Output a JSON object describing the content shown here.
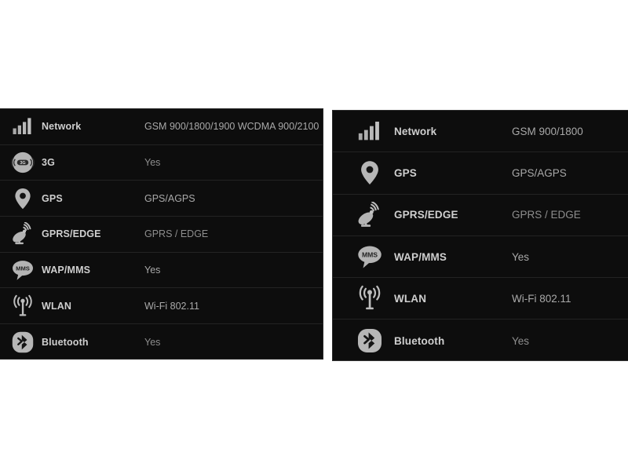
{
  "panels": [
    {
      "id": "left",
      "rows": [
        {
          "icon": "signal-bars-icon",
          "label": "Network",
          "value": "GSM 900/1800/1900 WCDMA 900/2100",
          "dim": false
        },
        {
          "icon": "three-g-badge-icon",
          "label": "3G",
          "value": "Yes",
          "dim": true
        },
        {
          "icon": "gps-pin-icon",
          "label": "GPS",
          "value": "GPS/AGPS",
          "dim": false
        },
        {
          "icon": "satellite-dish-icon",
          "label": "GPRS/EDGE",
          "value": "GPRS / EDGE",
          "dim": true
        },
        {
          "icon": "mms-bubble-icon",
          "label": "WAP/MMS",
          "value": "Yes",
          "dim": false
        },
        {
          "icon": "wlan-antenna-icon",
          "label": "WLAN",
          "value": "Wi-Fi 802.11",
          "dim": false
        },
        {
          "icon": "bluetooth-badge-icon",
          "label": "Bluetooth",
          "value": "Yes",
          "dim": true
        }
      ]
    },
    {
      "id": "right",
      "rows": [
        {
          "icon": "signal-bars-icon",
          "label": "Network",
          "value": "GSM 900/1800",
          "dim": false
        },
        {
          "icon": "gps-pin-icon",
          "label": "GPS",
          "value": "GPS/AGPS",
          "dim": false
        },
        {
          "icon": "satellite-dish-icon",
          "label": "GPRS/EDGE",
          "value": "GPRS / EDGE",
          "dim": true
        },
        {
          "icon": "mms-bubble-icon",
          "label": "WAP/MMS",
          "value": "Yes",
          "dim": false
        },
        {
          "icon": "wlan-antenna-icon",
          "label": "WLAN",
          "value": "Wi-Fi 802.11",
          "dim": false
        },
        {
          "icon": "bluetooth-badge-icon",
          "label": "Bluetooth",
          "value": "Yes",
          "dim": true
        }
      ]
    }
  ],
  "colors": {
    "panel_background": "#0d0d0d",
    "page_background": "#ffffff",
    "label_text": "#cfcfcf",
    "value_text": "#a9a9a9",
    "icon_fill": "#b4b4b4",
    "row_divider": "#232323"
  },
  "icon_labels": {
    "signal-bars-icon": "signal bars",
    "three-g-badge-icon": "3G",
    "gps-pin-icon": "location pin",
    "satellite-dish-icon": "satellite dish",
    "mms-bubble-icon": "MMS",
    "wlan-antenna-icon": "wireless antenna",
    "bluetooth-badge-icon": "bluetooth"
  }
}
